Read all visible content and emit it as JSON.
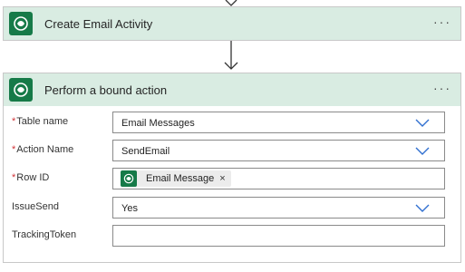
{
  "steps": [
    {
      "title": "Create Email Activity",
      "more": "···"
    },
    {
      "title": "Perform a bound action",
      "more": "···"
    }
  ],
  "form": {
    "table_name": {
      "label": "Table name",
      "required_mark": "*",
      "value": "Email Messages"
    },
    "action_name": {
      "label": "Action Name",
      "required_mark": "*",
      "value": "SendEmail"
    },
    "row_id": {
      "label": "Row ID",
      "required_mark": "*",
      "token_label": "Email Message",
      "token_close": "×"
    },
    "issue_send": {
      "label": "IssueSend",
      "value": "Yes"
    },
    "tracking_token": {
      "label": "TrackingToken",
      "value": ""
    }
  },
  "colors": {
    "header_bg": "#d9ece2",
    "logo_bg": "#167a48",
    "chevron": "#2f6fd0",
    "required": "#d13438"
  },
  "icons": {
    "connector": "dataverse-logo-icon",
    "expand": "chevron-down-icon",
    "more": "more-options-icon"
  }
}
